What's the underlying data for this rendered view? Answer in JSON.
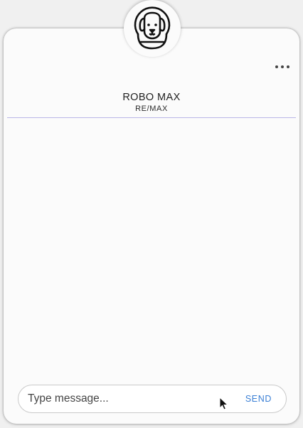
{
  "header": {
    "bot_name": "ROBO MAX",
    "bot_org": "RE/MAX",
    "avatar_icon": "dog-astronaut-icon",
    "menu_icon": "more-horizontal-icon"
  },
  "composer": {
    "placeholder": "Type message...",
    "value": "",
    "send_label": "SEND"
  },
  "colors": {
    "divider": "#b9b6e6",
    "send": "#3a7fd5"
  }
}
